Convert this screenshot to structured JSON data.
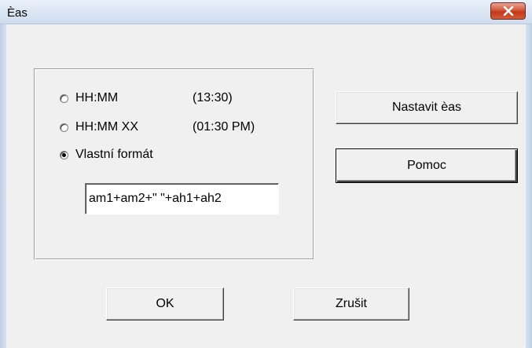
{
  "window": {
    "title": "Èas",
    "close_icon": "close-icon"
  },
  "format_group": {
    "options": [
      {
        "label": "HH:MM",
        "example": "(13:30)",
        "checked": false
      },
      {
        "label": "HH:MM XX",
        "example": "(01:30 PM)",
        "checked": false
      },
      {
        "label": "Vlastní formát",
        "example": "",
        "checked": true
      }
    ],
    "custom_format_value": "am1+am2+\" \"+ah1+ah2"
  },
  "buttons": {
    "set_time": "Nastavit èas",
    "help": "Pomoc",
    "ok": "OK",
    "cancel": "Zrušit"
  },
  "colors": {
    "close_button": "#c2391a",
    "dialog_background": "#f0f0f0",
    "title_bar": "#dbe6f4"
  }
}
